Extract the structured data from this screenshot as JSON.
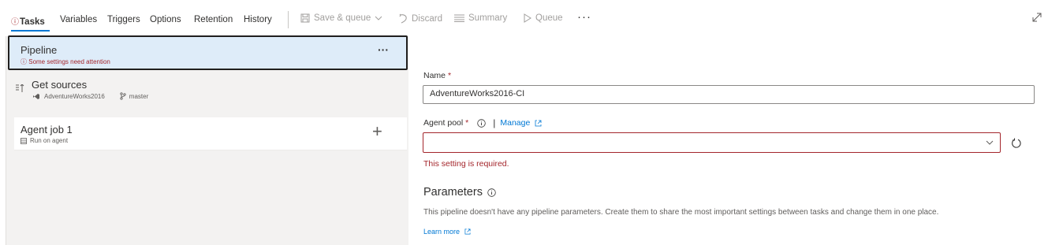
{
  "toolbar": {
    "tabs": [
      {
        "label": "Tasks",
        "active": true,
        "warning_icon": "error-circle-icon"
      },
      {
        "label": "Variables"
      },
      {
        "label": "Triggers"
      },
      {
        "label": "Options"
      },
      {
        "label": "Retention"
      },
      {
        "label": "History"
      }
    ],
    "actions": {
      "save_queue": "Save & queue",
      "discard": "Discard",
      "summary": "Summary",
      "queue": "Queue",
      "more": "···"
    }
  },
  "left_panel": {
    "pipeline": {
      "title": "Pipeline",
      "status": "Some settings need attention",
      "more": "···"
    },
    "get_sources": {
      "title": "Get sources",
      "repo": "AdventureWorks2016",
      "branch": "master"
    },
    "agent_job": {
      "title": "Agent job 1",
      "subtitle": "Run on agent",
      "add": "+"
    }
  },
  "form": {
    "name_label": "Name",
    "required_mark": "*",
    "name_value": "AdventureWorks2016-CI",
    "agent_pool_label": "Agent pool",
    "manage_link": "Manage",
    "agent_pool_value": "",
    "agent_pool_error": "This setting is required.",
    "parameters_title": "Parameters",
    "parameters_desc": "This pipeline doesn't have any pipeline parameters. Create them to share the most important settings between tasks and change them in one place.",
    "learn_more": "Learn more"
  },
  "colors": {
    "accent": "#0078d4",
    "error": "#a4262c",
    "selected_row": "#deecf9",
    "panel_bg": "#f3f2f1"
  }
}
